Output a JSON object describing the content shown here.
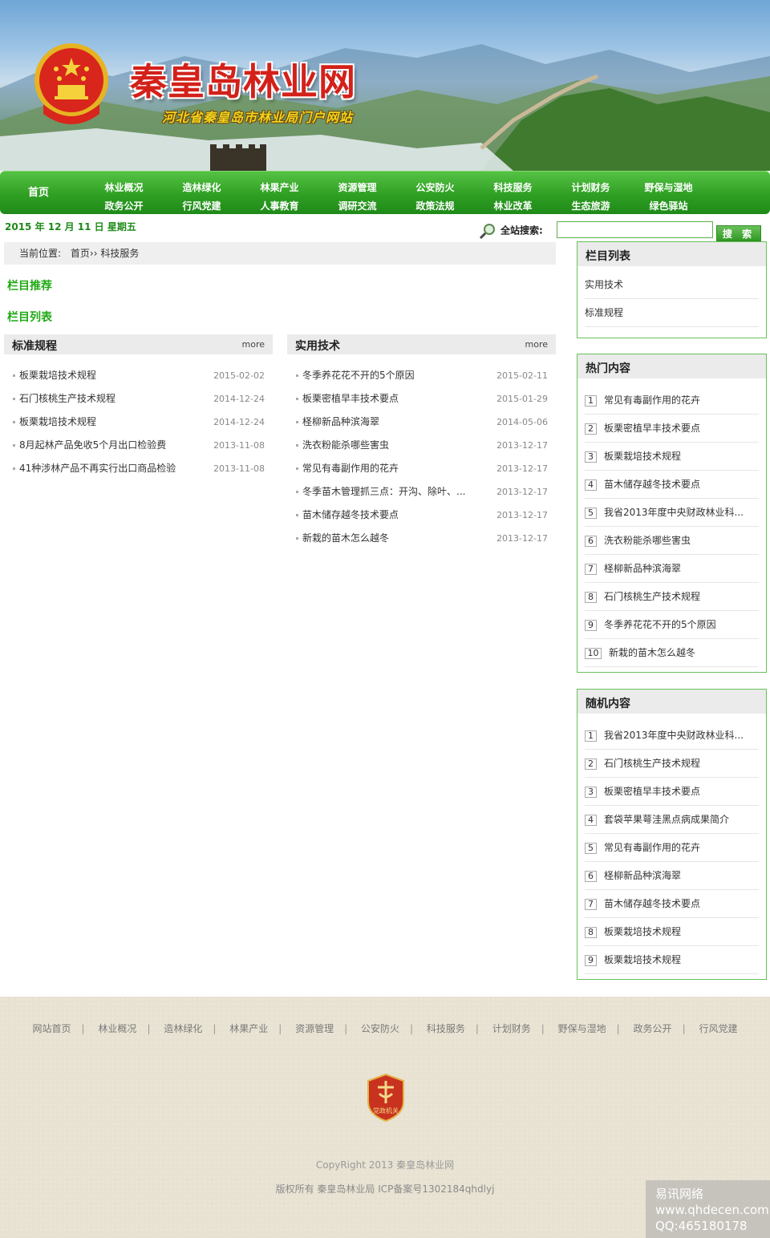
{
  "header": {
    "title": "秦皇岛林业网",
    "subtitle": "河北省秦皇岛市林业局门户网站"
  },
  "nav": {
    "home": "首页",
    "columns": [
      [
        "林业概况",
        "政务公开"
      ],
      [
        "造林绿化",
        "行风党建"
      ],
      [
        "林果产业",
        "人事教育"
      ],
      [
        "资源管理",
        "调研交流"
      ],
      [
        "公安防火",
        "政策法规"
      ],
      [
        "科技服务",
        "林业改革"
      ],
      [
        "计划财务",
        "生态旅游"
      ],
      [
        "野保与湿地",
        "绿色驿站"
      ]
    ]
  },
  "date": "2015 年 12 月 11 日 星期五",
  "search": {
    "label": "全站搜索:",
    "button": "搜 索"
  },
  "breadcrumb": {
    "prefix": "当前位置:",
    "home": "首页",
    "sep": "››",
    "current": "科技服务"
  },
  "sections": {
    "recommend": "栏目推荐",
    "list": "栏目列表"
  },
  "panels": [
    {
      "title": "标准规程",
      "more": "more",
      "items": [
        {
          "title": "板栗栽培技术规程",
          "date": "2015-02-02"
        },
        {
          "title": "石门核桃生产技术规程",
          "date": "2014-12-24"
        },
        {
          "title": "板栗栽培技术规程",
          "date": "2014-12-24"
        },
        {
          "title": "8月起林产品免收5个月出口检验费",
          "date": "2013-11-08"
        },
        {
          "title": "41种涉林产品不再实行出口商品检验",
          "date": "2013-11-08"
        }
      ]
    },
    {
      "title": "实用技术",
      "more": "more",
      "items": [
        {
          "title": "冬季养花花不开的5个原因",
          "date": "2015-02-11"
        },
        {
          "title": "板栗密植早丰技术要点",
          "date": "2015-01-29"
        },
        {
          "title": "柽柳新品种滨海翠",
          "date": "2014-05-06"
        },
        {
          "title": "洗衣粉能杀哪些害虫",
          "date": "2013-12-17"
        },
        {
          "title": "常见有毒副作用的花卉",
          "date": "2013-12-17"
        },
        {
          "title": "冬季苗木管理抓三点：开沟、除叶、...",
          "date": "2013-12-17"
        },
        {
          "title": "苗木储存越冬技术要点",
          "date": "2013-12-17"
        },
        {
          "title": "新栽的苗木怎么越冬",
          "date": "2013-12-17"
        }
      ]
    }
  ],
  "sidebar": {
    "columns": {
      "title": "栏目列表",
      "items": [
        "实用技术",
        "标准规程"
      ]
    },
    "hot": {
      "title": "热门内容",
      "items": [
        {
          "n": "1",
          "title": "常见有毒副作用的花卉"
        },
        {
          "n": "2",
          "title": "板栗密植早丰技术要点"
        },
        {
          "n": "3",
          "title": "板栗栽培技术规程"
        },
        {
          "n": "4",
          "title": "苗木储存越冬技术要点"
        },
        {
          "n": "5",
          "title": "我省2013年度中央财政林业科..."
        },
        {
          "n": "6",
          "title": "洗衣粉能杀哪些害虫"
        },
        {
          "n": "7",
          "title": "柽柳新品种滨海翠"
        },
        {
          "n": "8",
          "title": "石门核桃生产技术规程"
        },
        {
          "n": "9",
          "title": "冬季养花花不开的5个原因"
        },
        {
          "n": "10",
          "title": "新栽的苗木怎么越冬"
        }
      ]
    },
    "random": {
      "title": "随机内容",
      "items": [
        {
          "n": "1",
          "title": "我省2013年度中央财政林业科..."
        },
        {
          "n": "2",
          "title": "石门核桃生产技术规程"
        },
        {
          "n": "3",
          "title": "板栗密植早丰技术要点"
        },
        {
          "n": "4",
          "title": "套袋苹果萼洼黑点病成果简介"
        },
        {
          "n": "5",
          "title": "常见有毒副作用的花卉"
        },
        {
          "n": "6",
          "title": "柽柳新品种滨海翠"
        },
        {
          "n": "7",
          "title": "苗木储存越冬技术要点"
        },
        {
          "n": "8",
          "title": "板栗栽培技术规程"
        },
        {
          "n": "9",
          "title": "板栗栽培技术规程"
        }
      ]
    }
  },
  "footer": {
    "links": [
      "网站首页",
      "林业概况",
      "造林绿化",
      "林果产业",
      "资源管理",
      "公安防火",
      "科技服务",
      "计划财务",
      "野保与湿地",
      "政务公开",
      "行风党建"
    ],
    "badge_text": "党政机关",
    "copyright": "CopyRight 2013 秦皇岛林业网",
    "record": "版权所有 秦皇岛林业局   ICP备案号1302184qhdlyj"
  },
  "watermark": {
    "line1": "易讯网络",
    "line2": "www.qhdecen.com",
    "line3": "QQ:465180178"
  },
  "colors": {
    "accent_green": "#21a915",
    "nav_green": "#2f9f23",
    "title_red": "#d3211a"
  }
}
